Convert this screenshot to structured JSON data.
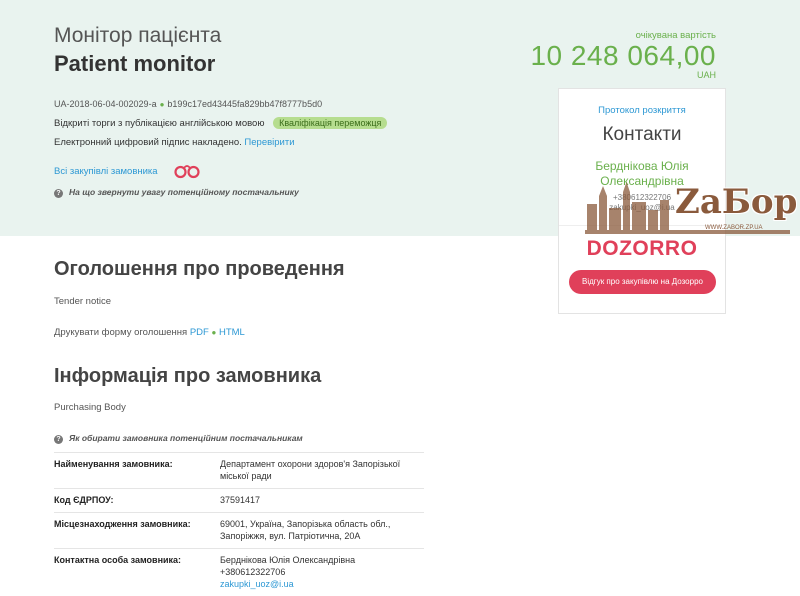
{
  "header": {
    "title_uk": "Монітор пацієнта",
    "title_en": "Patient monitor",
    "tender_id": "UA-2018-06-04-002029-a",
    "tender_hash": "b199c17ed43445fa829bb47f8777b5d0",
    "procedure": "Відкриті торги з публікацією англійською мовою",
    "status_badge": "Кваліфікація переможця",
    "signature_text": "Електронний цифровий підпис накладено.",
    "signature_link": "Перевірити",
    "all_purchases_link": "Всі закупівлі замовника",
    "attention_text": "На що звернути увагу потенційному постачальнику"
  },
  "price": {
    "label": "очікувана вартість",
    "value": "10 248 064,00",
    "currency": "UAH"
  },
  "side_card": {
    "protocol_link": "Протокол розкриття",
    "contacts_title": "Контакти",
    "contact_name": "Берднікова Юлія Олександрівна",
    "contact_phone": "+380612322706",
    "contact_email": "zakupki_uoz@i.ua",
    "dozorro_logo": "DOZORRO",
    "dozorro_button": "Відгук про закупівлю на Дозорро"
  },
  "watermark": {
    "text": "ZaБор",
    "url": "WWW.ZABOR.ZP.UA"
  },
  "notice": {
    "title": "Оголошення про проведення",
    "subtitle": "Tender notice",
    "print_label": "Друкувати форму оголошення",
    "pdf_link": "PDF",
    "html_link": "HTML"
  },
  "customer": {
    "title": "Інформація про замовника",
    "subtitle": "Purchasing Body",
    "hint": "Як обирати замовника потенційним постачальникам",
    "rows": [
      {
        "key": "Найменування замовника:",
        "value": "Департамент охорони здоров'я Запорізької міської ради"
      },
      {
        "key": "Код ЄДРПОУ:",
        "value": "37591417"
      },
      {
        "key": "Місцезнаходження замовника:",
        "value": "69001, Україна, Запорізька область обл., Запоріжжя, вул. Патріотична, 20А"
      },
      {
        "key": "Контактна особа замовника:",
        "value": "Берднікова Юлія Олександрівна",
        "phone": "+380612322706",
        "email": "zakupki_uoz@i.ua"
      }
    ]
  }
}
